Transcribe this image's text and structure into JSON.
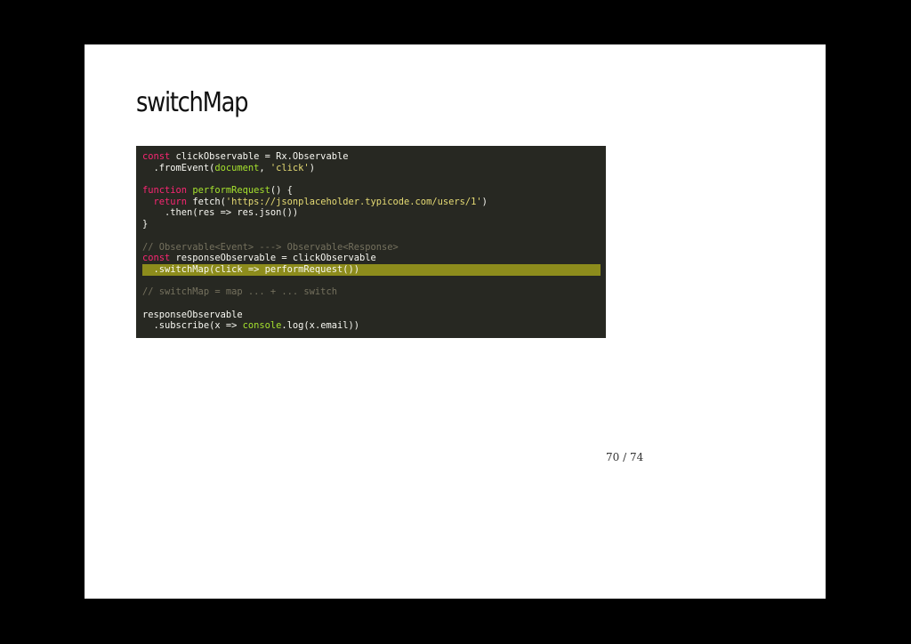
{
  "slide": {
    "title": "switchMap",
    "page_number": "70 / 74"
  },
  "code": {
    "lines": [
      {
        "highlighted": false,
        "tokens": [
          {
            "t": "kw",
            "s": "const"
          },
          {
            "t": "pl",
            "s": " clickObservable = Rx.Observable"
          }
        ]
      },
      {
        "highlighted": false,
        "tokens": [
          {
            "t": "pl",
            "s": "  .fromEvent("
          },
          {
            "t": "bi",
            "s": "document"
          },
          {
            "t": "pl",
            "s": ", "
          },
          {
            "t": "str",
            "s": "'click'"
          },
          {
            "t": "pl",
            "s": ")"
          }
        ]
      },
      {
        "highlighted": false,
        "tokens": []
      },
      {
        "highlighted": false,
        "tokens": [
          {
            "t": "kw",
            "s": "function"
          },
          {
            "t": "pl",
            "s": " "
          },
          {
            "t": "fn",
            "s": "performRequest"
          },
          {
            "t": "pl",
            "s": "() {"
          }
        ]
      },
      {
        "highlighted": false,
        "tokens": [
          {
            "t": "pl",
            "s": "  "
          },
          {
            "t": "kw",
            "s": "return"
          },
          {
            "t": "pl",
            "s": " fetch("
          },
          {
            "t": "str",
            "s": "'https://jsonplaceholder.typicode.com/users/1'"
          },
          {
            "t": "pl",
            "s": ")"
          }
        ]
      },
      {
        "highlighted": false,
        "tokens": [
          {
            "t": "pl",
            "s": "    .then(res => res.json())"
          }
        ]
      },
      {
        "highlighted": false,
        "tokens": [
          {
            "t": "pl",
            "s": "}"
          }
        ]
      },
      {
        "highlighted": false,
        "tokens": []
      },
      {
        "highlighted": false,
        "tokens": [
          {
            "t": "cm",
            "s": "// Observable<Event> ---> Observable<Response>"
          }
        ]
      },
      {
        "highlighted": false,
        "tokens": [
          {
            "t": "kw",
            "s": "const"
          },
          {
            "t": "pl",
            "s": " responseObservable = clickObservable"
          }
        ]
      },
      {
        "highlighted": true,
        "tokens": [
          {
            "t": "pl",
            "s": "  .switchMap(click => performRequest())"
          }
        ]
      },
      {
        "highlighted": false,
        "tokens": []
      },
      {
        "highlighted": false,
        "tokens": [
          {
            "t": "cm",
            "s": "// switchMap = map ... + ... switch"
          }
        ]
      },
      {
        "highlighted": false,
        "tokens": []
      },
      {
        "highlighted": false,
        "tokens": [
          {
            "t": "pl",
            "s": "responseObservable"
          }
        ]
      },
      {
        "highlighted": false,
        "tokens": [
          {
            "t": "pl",
            "s": "  .subscribe(x => "
          },
          {
            "t": "bi",
            "s": "console"
          },
          {
            "t": "pl",
            "s": ".log(x.email))"
          }
        ]
      }
    ]
  },
  "colors": {
    "page_background": "#000000",
    "slide_background": "#ffffff",
    "code_background": "#272822",
    "highlight_line": "#8d8c1c",
    "keyword": "#f92672",
    "function_name": "#a6e22e",
    "string": "#e6db74",
    "comment": "#75715e",
    "builtin": "#a6e22e",
    "plain": "#f8f8f2"
  }
}
